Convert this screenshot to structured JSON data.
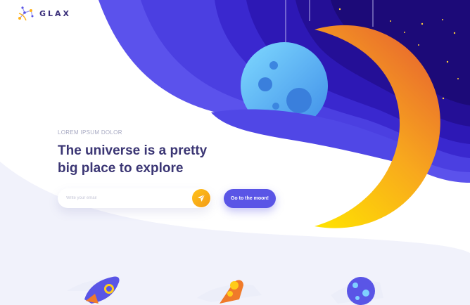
{
  "brand": {
    "name": "GLAX",
    "icon": "constellation-logo-icon"
  },
  "hero": {
    "eyebrow": "LOREM IPSUM DOLOR",
    "headline_line1": "The universe is a pretty",
    "headline_line2": "big place to explore"
  },
  "signup": {
    "email_placeholder": "Write your email",
    "send_icon": "paper-plane-icon",
    "cta_label": "Go to the moon!"
  },
  "features": {
    "icons": [
      "rocket-icon",
      "meteor-icon",
      "planet-icon"
    ]
  },
  "colors": {
    "primary": "#5a55e6",
    "deep_space": "#2b0f8f",
    "heading": "#3b3674",
    "moon_gradient": [
      "#ffd400",
      "#f07a2a"
    ],
    "send_button": "#f7a81b"
  }
}
